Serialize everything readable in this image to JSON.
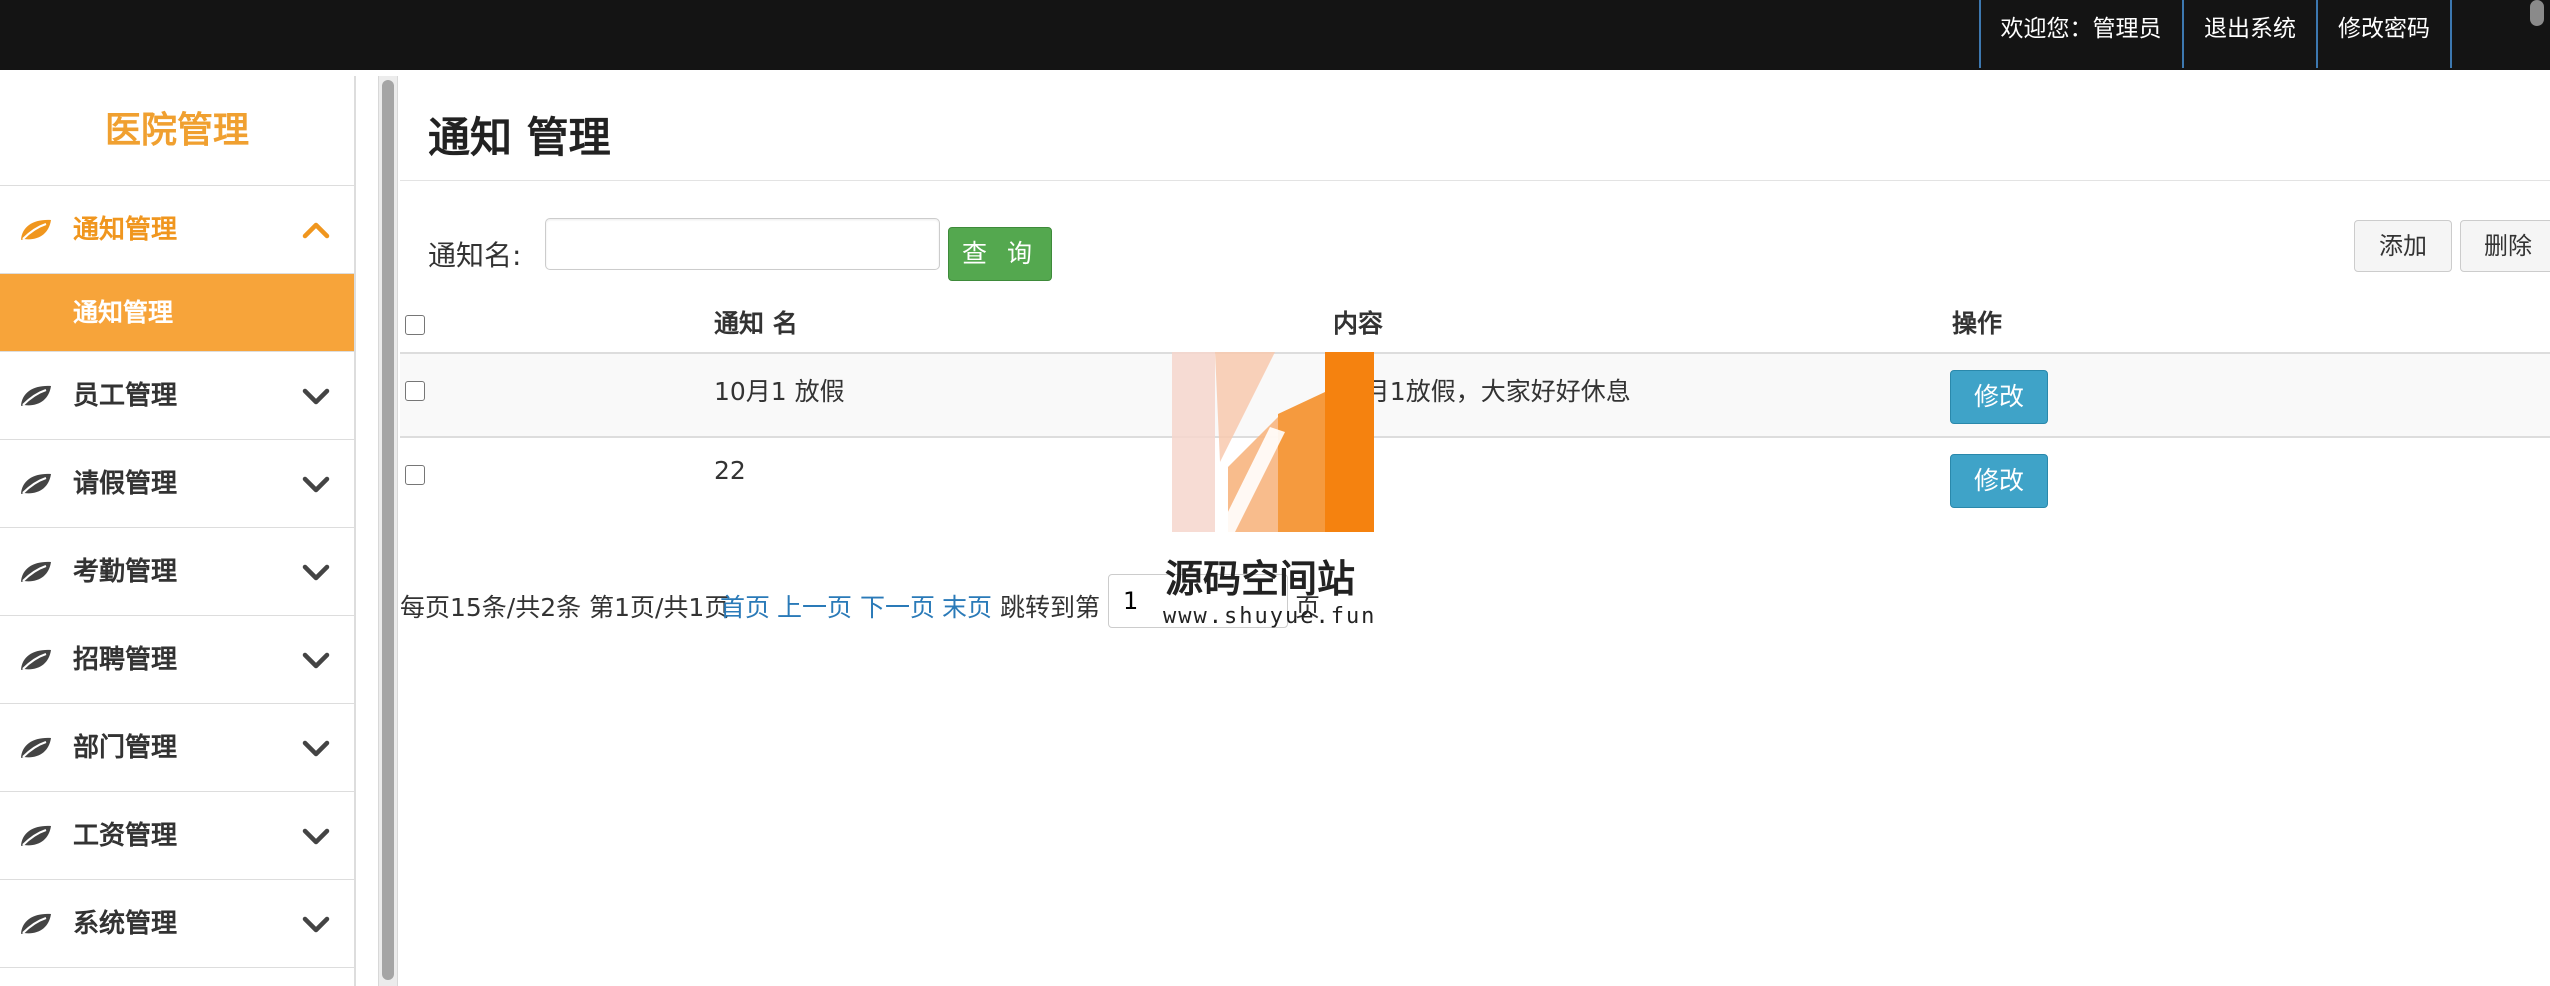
{
  "topbar": {
    "welcome": "欢迎您：管理员",
    "logout": "退出系统",
    "change_password": "修改密码"
  },
  "sidebar": {
    "brand": "医院管理",
    "items": [
      {
        "label": "通知管理",
        "icon": "leaf-icon",
        "expanded": true,
        "children": [
          {
            "label": "通知管理"
          }
        ]
      },
      {
        "label": "员工管理",
        "icon": "leaf-icon",
        "expanded": false
      },
      {
        "label": "请假管理",
        "icon": "leaf-icon",
        "expanded": false
      },
      {
        "label": "考勤管理",
        "icon": "leaf-icon",
        "expanded": false
      },
      {
        "label": "招聘管理",
        "icon": "leaf-icon",
        "expanded": false
      },
      {
        "label": "部门管理",
        "icon": "leaf-icon",
        "expanded": false
      },
      {
        "label": "工资管理",
        "icon": "leaf-icon",
        "expanded": false
      },
      {
        "label": "系统管理",
        "icon": "leaf-icon",
        "expanded": false
      }
    ]
  },
  "main": {
    "title": "通知 管理",
    "search": {
      "label": "通知名:",
      "value": "",
      "button": "查 询"
    },
    "actions": {
      "add": "添加",
      "delete": "删除"
    },
    "table": {
      "columns": [
        "通知 名",
        "内容",
        "操作"
      ],
      "rows": [
        {
          "name": "10月1 放假",
          "content": "10月1放假，大家好好休息",
          "action": "修改"
        },
        {
          "name": "22",
          "content": "22",
          "action": "修改"
        }
      ]
    },
    "pager": {
      "summary": "每页15条/共2条 第1页/共1页",
      "first": "首页",
      "prev": "上一页",
      "next": "下一页",
      "last": "末页",
      "jump_prefix": "跳转到第",
      "jump_value": "1",
      "jump_suffix": "页"
    }
  },
  "watermark": {
    "name": "源码空间站",
    "url": "www.shuyue.fun"
  },
  "colors": {
    "topbar": "#141414",
    "accent_orange": "#f7a43a",
    "search_green": "#54a84f",
    "edit_blue": "#3fa3c8",
    "link_blue": "#2a7ab8"
  }
}
